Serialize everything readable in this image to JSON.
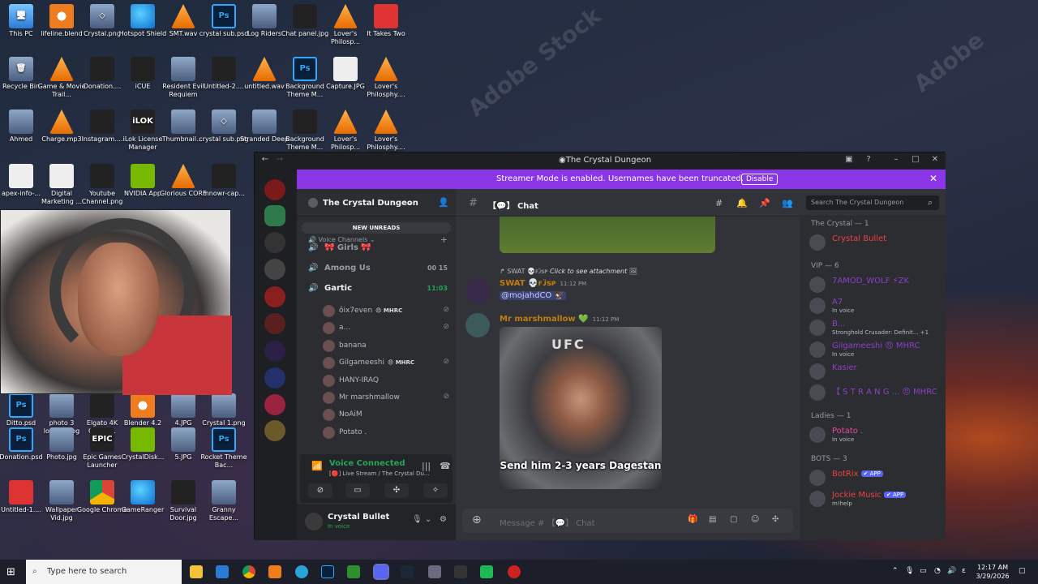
{
  "desktop": {
    "icons": [
      {
        "label": "This PC",
        "color": "c-pc",
        "glyph": "🖥"
      },
      {
        "label": "lifeline.blend",
        "color": "c-blend",
        "glyph": ""
      },
      {
        "label": "Crystal.png",
        "color": "c-img",
        "glyph": "◇"
      },
      {
        "label": "Hotspot Shield",
        "color": "c-edge",
        "glyph": ""
      },
      {
        "label": "SMT.wav",
        "color": "c-vlc",
        "glyph": ""
      },
      {
        "label": "crystal sub.psd",
        "color": "c-ps",
        "glyph": "Ps"
      },
      {
        "label": "Log Riders",
        "color": "c-img",
        "glyph": ""
      },
      {
        "label": "Chat panel.jpg",
        "color": "c-dark",
        "glyph": ""
      },
      {
        "label": "Lover's Philosp...",
        "color": "c-vlc",
        "glyph": ""
      },
      {
        "label": "It Takes Two",
        "color": "c-red",
        "glyph": ""
      },
      {
        "label": "Recycle Bin",
        "color": "c-img",
        "glyph": "🗑"
      },
      {
        "label": "Game & Movie Trail...",
        "color": "c-vlc",
        "glyph": ""
      },
      {
        "label": "Donation....",
        "color": "c-dark",
        "glyph": ""
      },
      {
        "label": "iCUE",
        "color": "c-dark",
        "glyph": ""
      },
      {
        "label": "Resident Evil Requiem",
        "color": "c-img",
        "glyph": ""
      },
      {
        "label": "Untitled-2....",
        "color": "c-dark",
        "glyph": ""
      },
      {
        "label": "untitled.wav",
        "color": "c-vlc",
        "glyph": ""
      },
      {
        "label": "Background Theme M...",
        "color": "c-ps",
        "glyph": "Ps"
      },
      {
        "label": "Capture.JPG",
        "color": "c-doc",
        "glyph": ""
      },
      {
        "label": "Lover's Philosphy....",
        "color": "c-vlc",
        "glyph": ""
      },
      {
        "label": "Ahmed",
        "color": "c-img",
        "glyph": ""
      },
      {
        "label": "Charge.mp3",
        "color": "c-vlc",
        "glyph": ""
      },
      {
        "label": "Instagram....",
        "color": "c-dark",
        "glyph": ""
      },
      {
        "label": "iLok License Manager",
        "color": "c-dark",
        "glyph": "iLOK"
      },
      {
        "label": "Thumbnail....",
        "color": "c-img",
        "glyph": ""
      },
      {
        "label": "crystal sub.png",
        "color": "c-img",
        "glyph": "◇"
      },
      {
        "label": "Stranded Deep",
        "color": "c-img",
        "glyph": ""
      },
      {
        "label": "Background Theme M...",
        "color": "c-dark",
        "glyph": ""
      },
      {
        "label": "Lover's Philosp...",
        "color": "c-vlc",
        "glyph": ""
      },
      {
        "label": "Lover's Philosphy....",
        "color": "c-vlc",
        "glyph": ""
      },
      {
        "label": "apex-info-...",
        "color": "c-doc",
        "glyph": ""
      },
      {
        "label": "Digital Marketing ...",
        "color": "c-doc",
        "glyph": ""
      },
      {
        "label": "Youtube Channel.png",
        "color": "c-dark",
        "glyph": ""
      },
      {
        "label": "NVIDIA App",
        "color": "c-green",
        "glyph": ""
      },
      {
        "label": "Glorious CORE",
        "color": "c-vlc",
        "glyph": ""
      },
      {
        "label": "mnowr-cap...",
        "color": "c-dark",
        "glyph": ""
      },
      {
        "label": "Ditto.psd",
        "color": "c-ps",
        "glyph": "Ps"
      },
      {
        "label": "photo 3 loading.jpg",
        "color": "c-img",
        "glyph": ""
      },
      {
        "label": "Elgato 4K Captur...",
        "color": "c-dark",
        "glyph": ""
      },
      {
        "label": "Blender 4.2",
        "color": "c-blend",
        "glyph": ""
      },
      {
        "label": "4.JPG",
        "color": "c-img",
        "glyph": ""
      },
      {
        "label": "Crystal 1.png",
        "color": "c-img",
        "glyph": ""
      },
      {
        "label": "Donation.psd",
        "color": "c-ps",
        "glyph": "Ps"
      },
      {
        "label": "Photo.jpg",
        "color": "c-img",
        "glyph": ""
      },
      {
        "label": "Epic Games Launcher",
        "color": "c-dark",
        "glyph": "EPIC"
      },
      {
        "label": "CrystalDisk...",
        "color": "c-green",
        "glyph": ""
      },
      {
        "label": "5.JPG",
        "color": "c-img",
        "glyph": ""
      },
      {
        "label": "Rocket Theme Bac...",
        "color": "c-ps",
        "glyph": "Ps"
      },
      {
        "label": "Untitled-1....",
        "color": "c-red",
        "glyph": ""
      },
      {
        "label": "Wallpaper Vid.jpg",
        "color": "c-img",
        "glyph": ""
      },
      {
        "label": "Google Chrome",
        "color": "c-chrome",
        "glyph": ""
      },
      {
        "label": "GameRanger",
        "color": "c-edge",
        "glyph": ""
      },
      {
        "label": "Survival Door.jpg",
        "color": "c-dark",
        "glyph": ""
      },
      {
        "label": "Granny Escape...",
        "color": "c-img",
        "glyph": ""
      }
    ]
  },
  "window": {
    "title": "The Crystal Dungeon"
  },
  "banner": {
    "text": "Streamer Mode is enabled. Usernames have been truncated.",
    "button": "Disable"
  },
  "server": {
    "name": "The Crystal Dungeon",
    "new_unreads": "NEW UNREADS",
    "category": "Voice Channels",
    "channels": [
      {
        "name": "🎀 Girls 🎀",
        "right": ""
      },
      {
        "name": "Among Us",
        "right": "00  15"
      },
      {
        "name": "Gartic",
        "right": "11:03"
      }
    ],
    "members": [
      {
        "name": "ôix7even",
        "tag": "😠 MHRC"
      },
      {
        "name": "a...",
        "tag": ""
      },
      {
        "name": "banana",
        "tag": ""
      },
      {
        "name": "Gilgameeshi",
        "tag": "😠 MHRC"
      },
      {
        "name": "HANY-IRAQ",
        "tag": ""
      },
      {
        "name": "Mr marshmallow",
        "tag": ""
      },
      {
        "name": "NoAiM",
        "tag": ""
      },
      {
        "name": "Potato .",
        "tag": ""
      }
    ]
  },
  "voice": {
    "status": "Voice Connected",
    "sub": "[🔴] Live Stream / The Crystal Du..."
  },
  "user": {
    "name": "Crystal Bullet",
    "status": "In voice"
  },
  "chat": {
    "channel": "Chat",
    "search_placeholder": "Search The Crystal Dungeon",
    "reply_name": "SWAT 💀ꜰᴊ̈ꜱᴘ",
    "reply_text": "Click to see attachment",
    "msg1": {
      "author": "SWAT 💀ꜰᴊ̈ꜱᴘ",
      "time": "11:12 PM",
      "mention": "@mojahdCO 🦅"
    },
    "msg2": {
      "author": "Mr marshmallow 💚",
      "time": "11:12 PM",
      "caption": "Send him 2-3 years Dagestan",
      "logo": "UFC"
    },
    "input_placeholder": "Message # 【💬】 Chat"
  },
  "memberlist": [
    {
      "cat": "The Crystal — 1"
    },
    {
      "name": "Crystal Bullet",
      "status": "",
      "color": "#f23f43"
    },
    {
      "cat": "VIP — 6"
    },
    {
      "name": "7AMOD_WOLF ⚡ZK",
      "status": "",
      "color": "#8e3fc9"
    },
    {
      "name": "A7",
      "status": "In voice",
      "color": "#8e3fc9"
    },
    {
      "name": "B...",
      "status": "Stronghold Crusader: Definit... +1",
      "color": "#8e3fc9"
    },
    {
      "name": "Gilgameeshi 😠 MHRC",
      "status": "In voice",
      "color": "#8e3fc9"
    },
    {
      "name": "Kasier",
      "status": "",
      "color": "#8e3fc9"
    },
    {
      "name": "【 S T R A N G ... 😠 MHRC",
      "status": "",
      "color": "#8e3fc9"
    },
    {
      "cat": "Ladies — 1"
    },
    {
      "name": "Potato .",
      "status": "In voice",
      "color": "#eb459e"
    },
    {
      "cat": "BOTS — 3"
    },
    {
      "name": "BotRix",
      "status": "",
      "color": "#f23f43",
      "app": "✔ APP"
    },
    {
      "name": "Jockie Music",
      "status": "m!help",
      "color": "#f23f43",
      "app": "✔ APP"
    }
  ],
  "taskbar": {
    "search": "Type here to search",
    "time": "12:17 AM",
    "date": "3/29/2026",
    "lang": "ε"
  }
}
